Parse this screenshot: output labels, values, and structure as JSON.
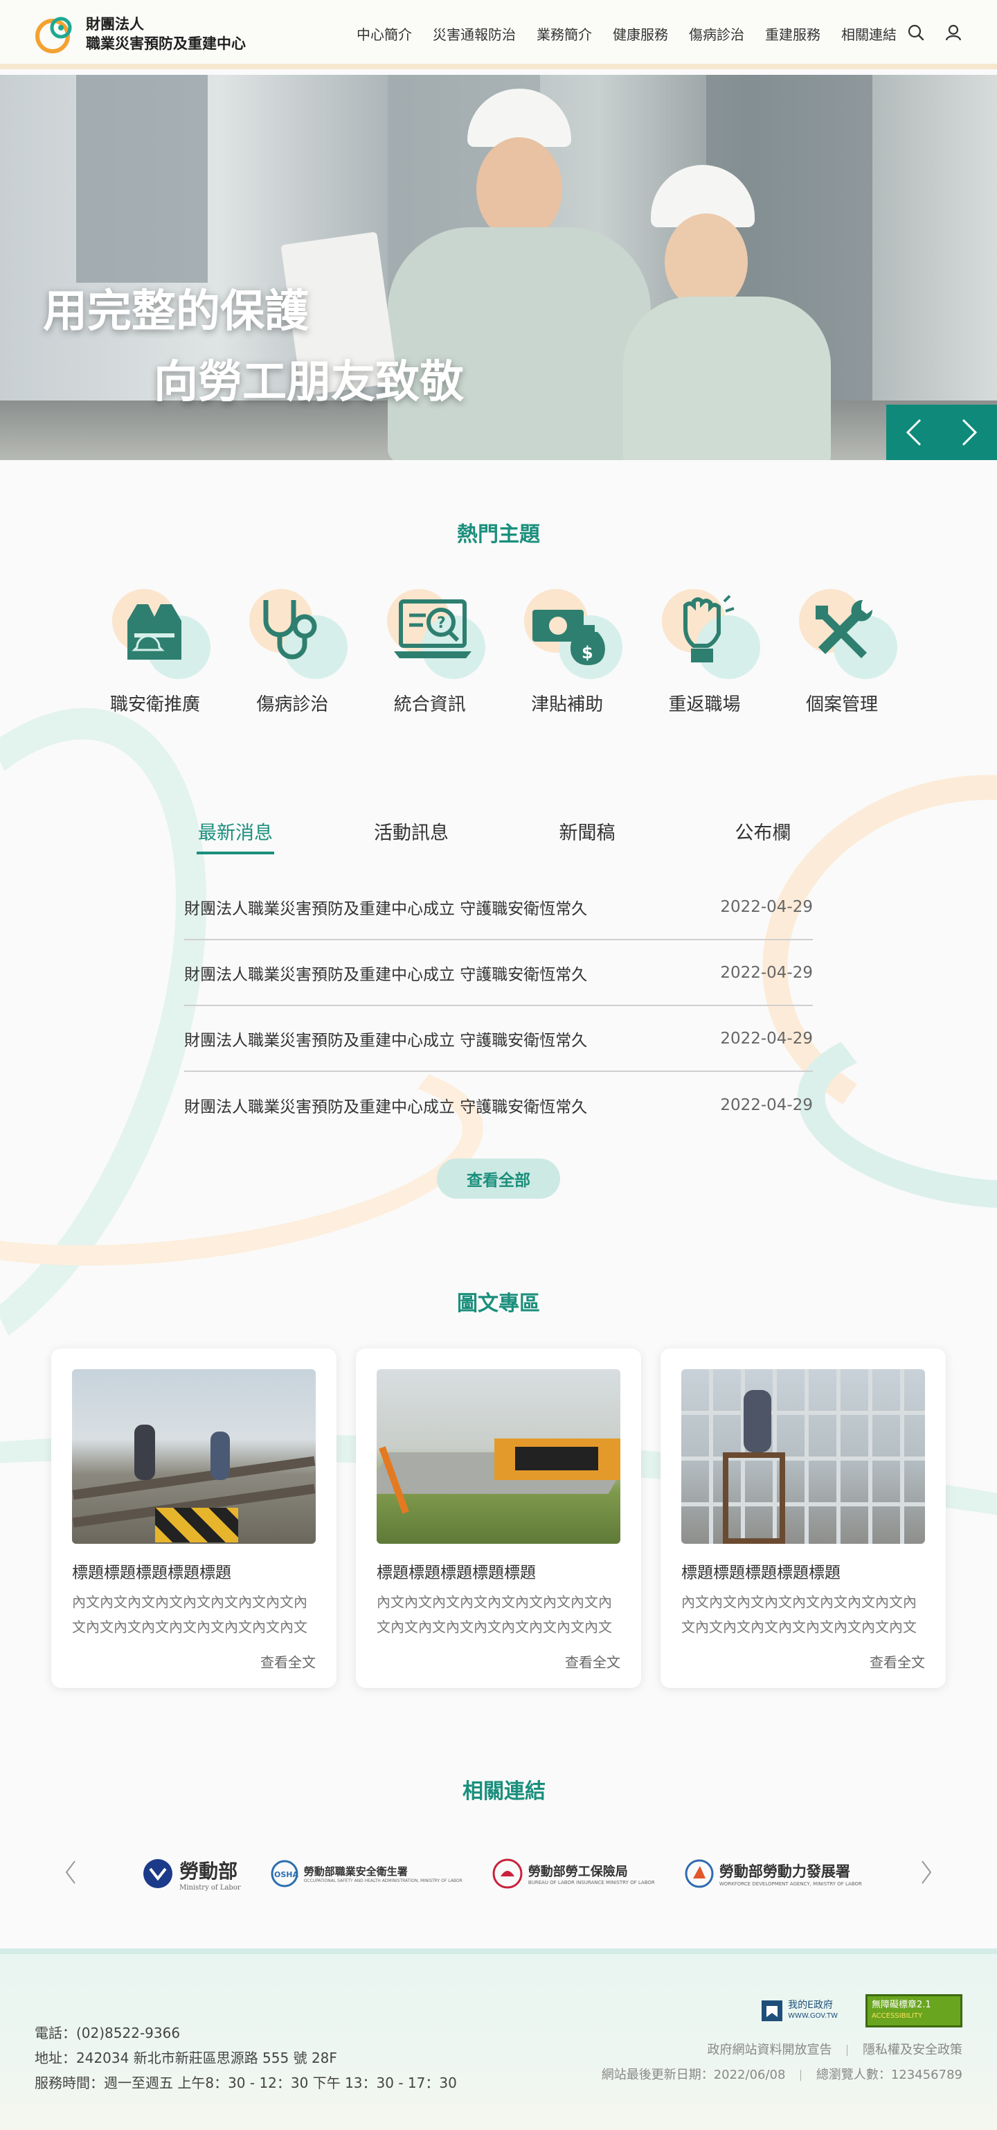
{
  "header": {
    "org_line1": "財團法人",
    "org_line2": "職業災害預防及重建中心",
    "nav": [
      "中心簡介",
      "災害通報防治",
      "業務簡介",
      "健康服務",
      "傷病診治",
      "重建服務",
      "相關連結"
    ],
    "search_icon": "search-icon",
    "user_icon": "user-icon"
  },
  "hero": {
    "line1": "用完整的保護",
    "line2": "向勞工朋友致敬"
  },
  "topics": {
    "title": "熱門主題",
    "items": [
      {
        "label": "職安衛推廣",
        "icon": "safety-vest-icon"
      },
      {
        "label": "傷病診治",
        "icon": "stethoscope-icon"
      },
      {
        "label": "統合資訊",
        "icon": "laptop-help-icon"
      },
      {
        "label": "津貼補助",
        "icon": "money-bag-icon"
      },
      {
        "label": "重返職場",
        "icon": "raised-fist-icon"
      },
      {
        "label": "個案管理",
        "icon": "tools-icon"
      }
    ]
  },
  "news": {
    "tabs": [
      "最新消息",
      "活動訊息",
      "新聞稿",
      "公布欄"
    ],
    "active_tab": 0,
    "rows": [
      {
        "title": "財團法人職業災害預防及重建中心成立 守護職安衛恆常久",
        "date": "2022-04-29"
      },
      {
        "title": "財團法人職業災害預防及重建中心成立 守護職安衛恆常久",
        "date": "2022-04-29"
      },
      {
        "title": "財團法人職業災害預防及重建中心成立 守護職安衛恆常久",
        "date": "2022-04-29"
      },
      {
        "title": "財團法人職業災害預防及重建中心成立 守護職安衛恆常久",
        "date": "2022-04-29"
      }
    ],
    "view_all": "查看全部"
  },
  "gallery": {
    "title": "圖文專區",
    "cards": [
      {
        "title": "標題標題標題標題標題",
        "desc": "內文內文內文內文內文內文內文內文內文內文內文內文內文內文內文內文內文內文內文",
        "more": "查看全文"
      },
      {
        "title": "標題標題標題標題標題",
        "desc": "內文內文內文內文內文內文內文內文內文內文內文內文內文內文內文內文內文內文內文",
        "more": "查看全文"
      },
      {
        "title": "標題標題標題標題標題",
        "desc": "內文內文內文內文內文內文內文內文內文內文內文內文內文內文內文內文內文內文內文",
        "more": "查看全文"
      }
    ]
  },
  "links": {
    "title": "相關連結",
    "items": [
      {
        "name": "勞動部",
        "sub": "Ministry of Labor"
      },
      {
        "name": "勞動部職業安全衛生署",
        "sub": "OCCUPATIONAL SAFETY AND HEALTH ADMINISTRATION, MINISTRY OF LABOR"
      },
      {
        "name": "勞動部勞工保險局",
        "sub": "BUREAU OF LABOR INSURANCE MINISTRY OF LABOR"
      },
      {
        "name": "勞動部勞動力發展署",
        "sub": "WORKFORCE DEVELOPMENT AGENCY, MINISTRY OF LABOR"
      }
    ]
  },
  "footer": {
    "phone": "電話：(02)8522-9366",
    "address": "地址：242034 新北市新莊區思源路 555 號 28F",
    "hours": "服務時間：週一至週五 上午8：30 - 12：30 下午 13：30 - 17：30",
    "egov_name": "我的E政府",
    "egov_url": "WWW.GOV.TW",
    "a11y_name": "無障礙標章2.1",
    "a11y_sub": "ACCESSIBILITY",
    "link_open_data": "政府網站資料開放宣告",
    "link_privacy": "隱私權及安全政策",
    "updated": "網站最後更新日期：2022/06/08",
    "visitors": "總瀏覽人數：123456789"
  },
  "colors": {
    "brand_green": "#1a8f7c",
    "peach": "#fbe5cd",
    "mint": "#d6efea"
  }
}
